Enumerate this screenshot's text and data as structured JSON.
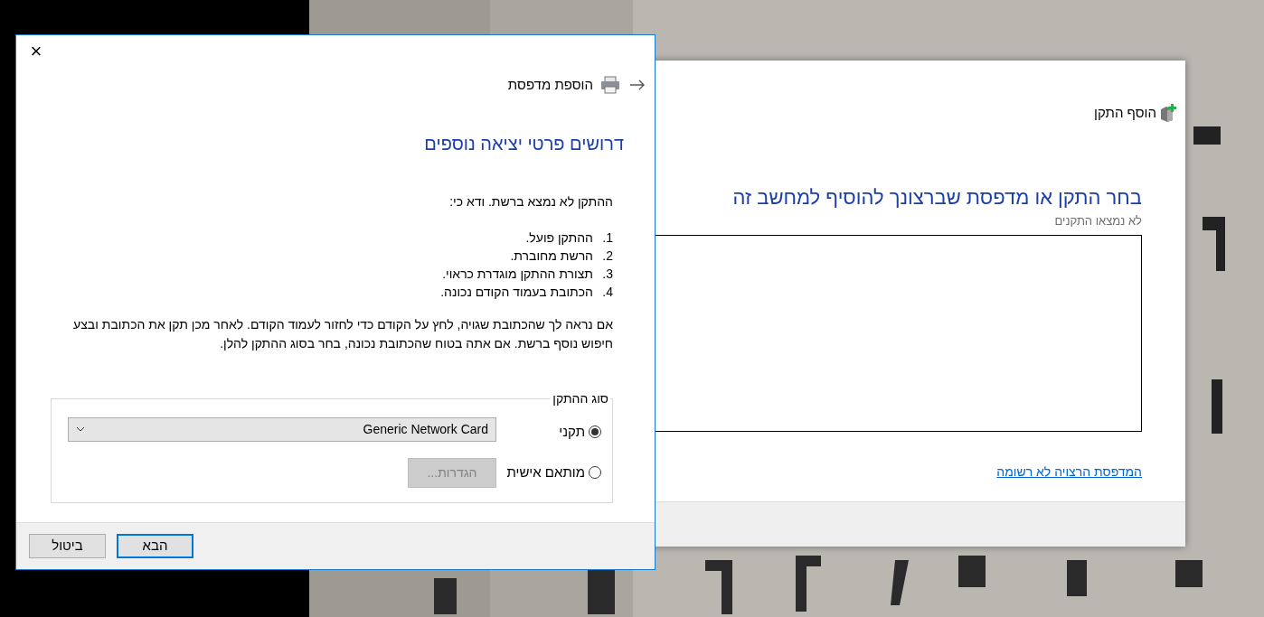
{
  "back_window": {
    "title": "הוסף התקן",
    "heading": "בחר התקן או מדפסת שברצונך להוסיף למחשב זה",
    "status": "לא נמצאו התקנים",
    "link": "המדפסת הרצויה לא רשומה"
  },
  "front_window": {
    "close": "×",
    "title": "הוספת מדפסת",
    "heading": "דרושים פרטי יציאה נוספים",
    "intro": "ההתקן לא נמצא ברשת. ודא כי:",
    "steps": [
      {
        "number": "1.",
        "text": "ההתקן פועל."
      },
      {
        "number": "2.",
        "text": "הרשת מחוברת."
      },
      {
        "number": "3.",
        "text": "תצורת ההתקן מוגדרת כראוי."
      },
      {
        "number": "4.",
        "text": "הכתובת בעמוד הקודם נכונה."
      }
    ],
    "note": "אם נראה לך שהכתובת שגויה, לחץ על הקודם כדי לחזור לעמוד הקודם. לאחר מכן תקן את הכתובת ובצע חיפוש נוסף ברשת. אם אתה בטוח שהכתובת נכונה, בחר בסוג ההתקן להלן.",
    "group": {
      "legend": "סוג ההתקן",
      "options": [
        {
          "label": "תקני",
          "selected": true
        },
        {
          "label": "מותאם אישית",
          "selected": false
        }
      ],
      "dropdown": {
        "value": "Generic Network Card"
      },
      "settings_button": {
        "label": "הגדרות...",
        "disabled": true
      }
    },
    "buttons": [
      {
        "label": "הבא",
        "default": true
      },
      {
        "label": "ביטול",
        "default": false
      }
    ]
  }
}
